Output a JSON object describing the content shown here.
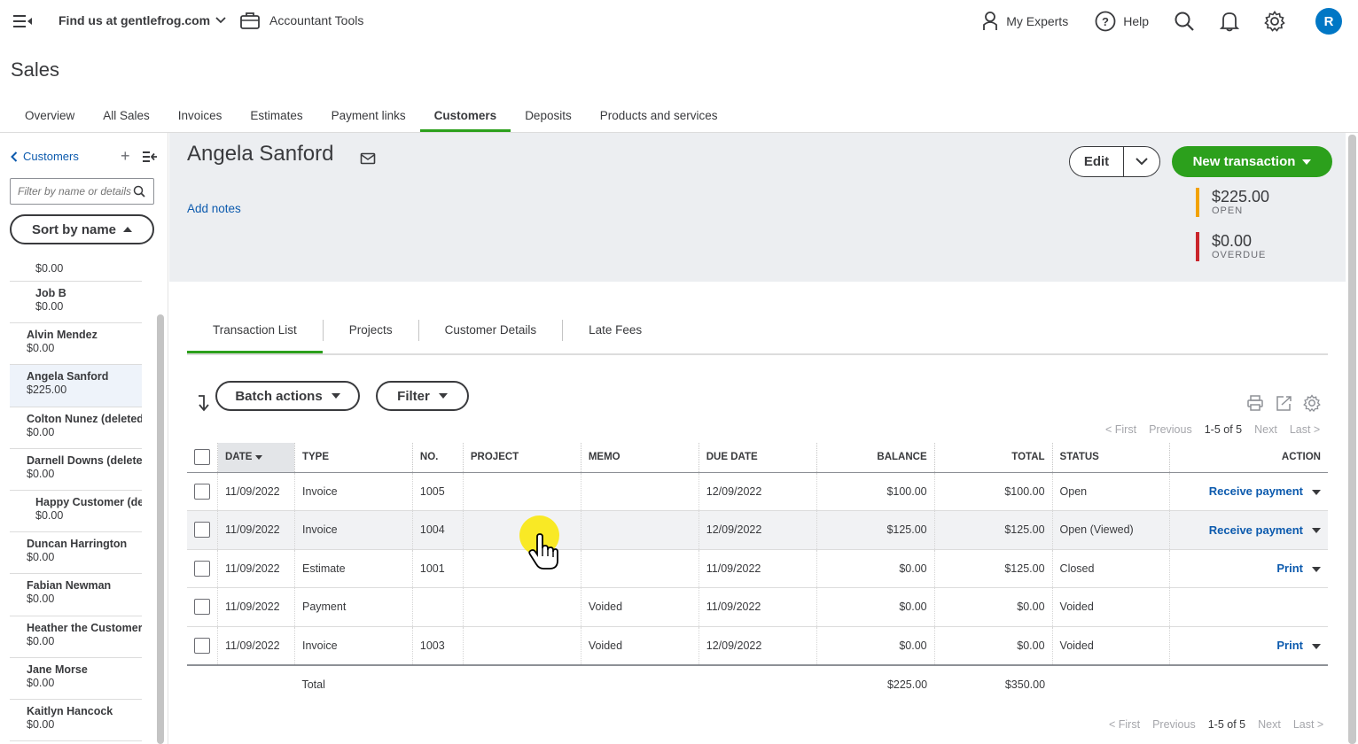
{
  "topbar": {
    "company": "Find us at gentlefrog.com",
    "accountant_tools": "Accountant Tools",
    "my_experts": "My Experts",
    "help": "Help",
    "avatar_initial": "R"
  },
  "page": {
    "title": "Sales"
  },
  "main_tabs": [
    "Overview",
    "All Sales",
    "Invoices",
    "Estimates",
    "Payment links",
    "Customers",
    "Deposits",
    "Products and services"
  ],
  "main_tab_active": "Customers",
  "sidebar": {
    "back_label": "Customers",
    "filter_placeholder": "Filter by name or details",
    "sort_label": "Sort by name",
    "customers": [
      {
        "name": "",
        "balance": "$0.00",
        "sub": true
      },
      {
        "name": "Job B",
        "balance": "$0.00",
        "sub": true
      },
      {
        "name": "Alvin Mendez",
        "balance": "$0.00"
      },
      {
        "name": "Angela Sanford",
        "balance": "$225.00",
        "selected": true
      },
      {
        "name": "Colton Nunez (deleted)",
        "balance": "$0.00"
      },
      {
        "name": "Darnell Downs (deleted)",
        "balance": "$0.00"
      },
      {
        "name": "Happy Customer (deleted)",
        "balance": "$0.00",
        "sub": true
      },
      {
        "name": "Duncan Harrington",
        "balance": "$0.00"
      },
      {
        "name": "Fabian Newman",
        "balance": "$0.00"
      },
      {
        "name": "Heather the Customer",
        "balance": "$0.00"
      },
      {
        "name": "Jane Morse",
        "balance": "$0.00"
      },
      {
        "name": "Kaitlyn Hancock",
        "balance": "$0.00"
      }
    ]
  },
  "customer": {
    "name": "Angela Sanford",
    "add_notes": "Add notes",
    "edit_label": "Edit",
    "new_transaction_label": "New transaction",
    "open_amount": "$225.00",
    "open_label": "OPEN",
    "overdue_amount": "$0.00",
    "overdue_label": "OVERDUE",
    "open_color": "#f2a200",
    "overdue_color": "#c9252c"
  },
  "sub_tabs": [
    "Transaction List",
    "Projects",
    "Customer Details",
    "Late Fees"
  ],
  "toolbar": {
    "batch_actions": "Batch actions",
    "filter": "Filter"
  },
  "pager": {
    "first": "< First",
    "previous": "Previous",
    "range": "1-5 of 5",
    "next": "Next",
    "last": "Last >"
  },
  "table": {
    "headers": [
      "DATE",
      "TYPE",
      "NO.",
      "PROJECT",
      "MEMO",
      "DUE DATE",
      "BALANCE",
      "TOTAL",
      "STATUS",
      "ACTION"
    ],
    "rows": [
      {
        "date": "11/09/2022",
        "type": "Invoice",
        "no": "1005",
        "project": "",
        "memo": "",
        "due": "12/09/2022",
        "balance": "$100.00",
        "total": "$100.00",
        "status": "Open",
        "action": "Receive payment"
      },
      {
        "date": "11/09/2022",
        "type": "Invoice",
        "no": "1004",
        "project": "",
        "memo": "",
        "due": "12/09/2022",
        "balance": "$125.00",
        "total": "$125.00",
        "status": "Open (Viewed)",
        "action": "Receive payment"
      },
      {
        "date": "11/09/2022",
        "type": "Estimate",
        "no": "1001",
        "project": "",
        "memo": "",
        "due": "11/09/2022",
        "balance": "$0.00",
        "total": "$125.00",
        "status": "Closed",
        "action": "Print"
      },
      {
        "date": "11/09/2022",
        "type": "Payment",
        "no": "",
        "project": "",
        "memo": "Voided",
        "due": "11/09/2022",
        "balance": "$0.00",
        "total": "$0.00",
        "status": "Voided",
        "action": ""
      },
      {
        "date": "11/09/2022",
        "type": "Invoice",
        "no": "1003",
        "project": "",
        "memo": "Voided",
        "due": "12/09/2022",
        "balance": "$0.00",
        "total": "$0.00",
        "status": "Voided",
        "action": "Print"
      }
    ],
    "total_label": "Total",
    "total_balance": "$225.00",
    "total_total": "$350.00"
  },
  "colors": {
    "accent_green": "#2ca01c",
    "link_blue": "#0d5bae",
    "closed_green": "#2ca01c"
  }
}
